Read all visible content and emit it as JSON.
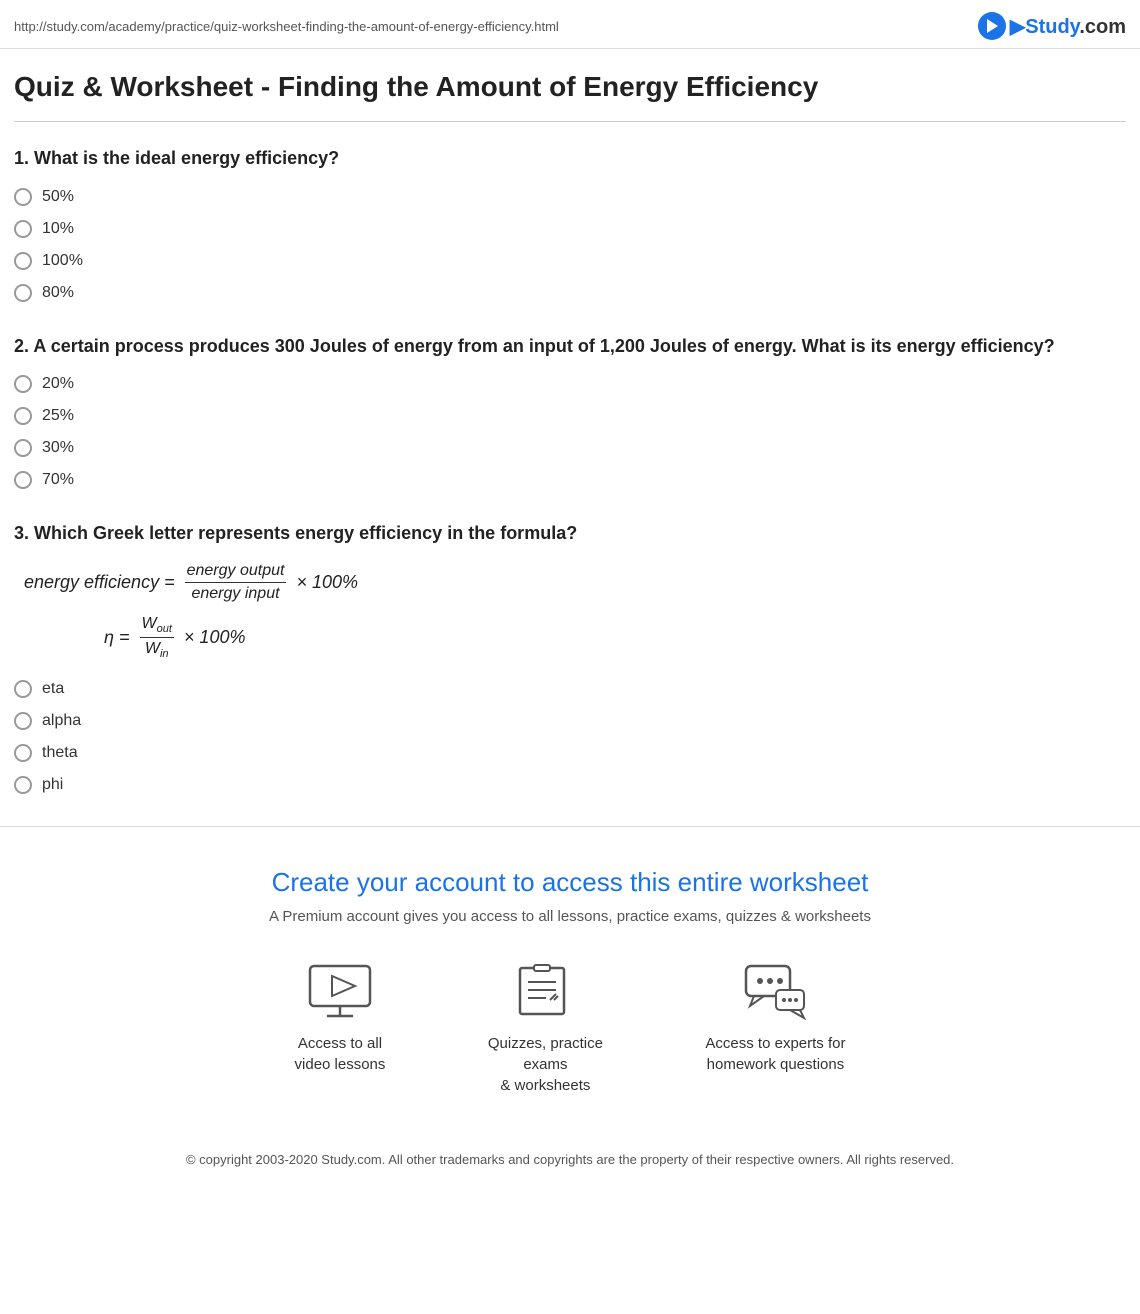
{
  "url": "http://study.com/academy/practice/quiz-worksheet-finding-the-amount-of-energy-efficiency.html",
  "logo_text": "Study.com",
  "page_title": "Quiz & Worksheet - Finding the Amount of Energy Efficiency",
  "questions": [
    {
      "number": "1.",
      "text": "What is the ideal energy efficiency?",
      "options": [
        "50%",
        "10%",
        "100%",
        "80%"
      ]
    },
    {
      "number": "2.",
      "text": "A certain process produces 300 Joules of energy from an input of 1,200 Joules of energy. What is its energy efficiency?",
      "options": [
        "20%",
        "25%",
        "30%",
        "70%"
      ]
    },
    {
      "number": "3.",
      "text": "Which Greek letter represents energy efficiency in the formula?",
      "options": [
        "eta",
        "alpha",
        "theta",
        "phi"
      ]
    }
  ],
  "signup": {
    "title": "Create your account to access this entire worksheet",
    "subtitle": "A Premium account gives you access to all lessons, practice exams, quizzes & worksheets",
    "features": [
      {
        "label": "Access to all\nvideo lessons",
        "icon": "video-icon"
      },
      {
        "label": "Quizzes, practice exams\n& worksheets",
        "icon": "quiz-icon"
      },
      {
        "label": "Access to experts for\nhomework questions",
        "icon": "expert-icon"
      }
    ]
  },
  "footer": "© copyright 2003-2020 Study.com. All other trademarks and copyrights are the property of their respective owners. All rights reserved."
}
